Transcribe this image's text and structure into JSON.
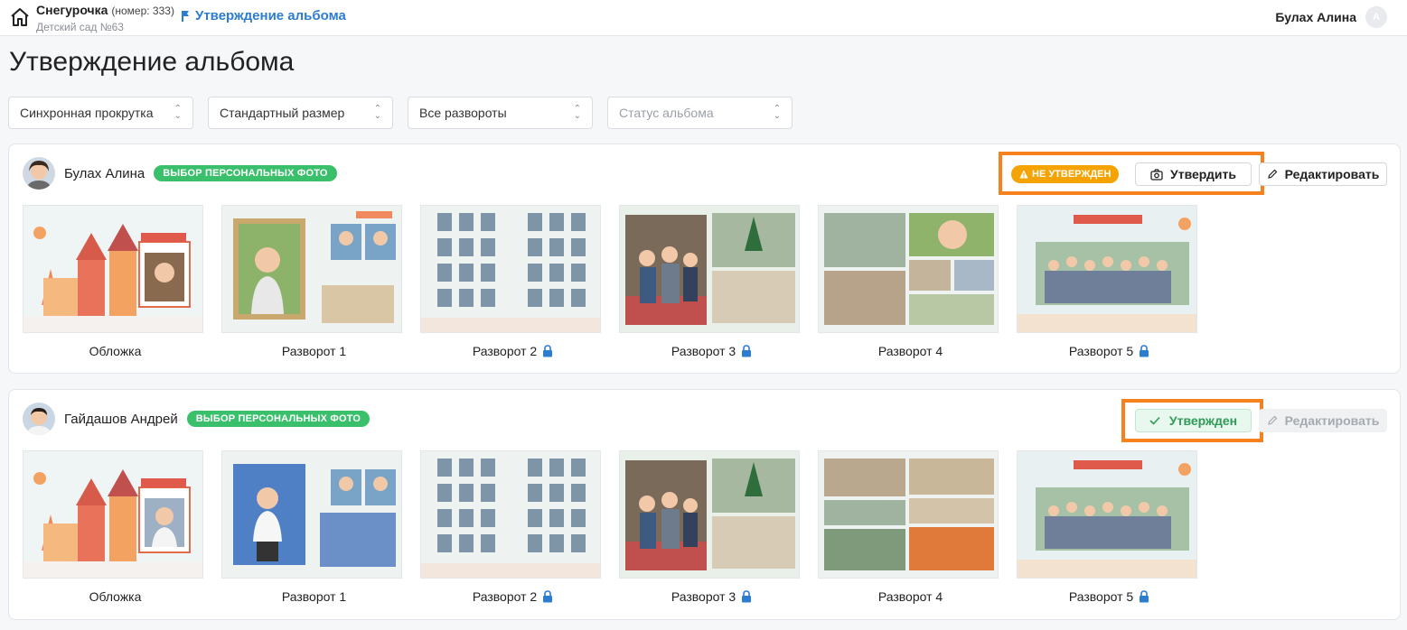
{
  "header": {
    "org_name": "Снегурочка",
    "org_number": "(номер: 333)",
    "org_sub": "Детский сад №63",
    "breadcrumb": "Утверждение альбома",
    "user_name": "Булах Алина",
    "user_initial": "А"
  },
  "page_title": "Утверждение альбома",
  "filters": {
    "scroll": "Синхронная прокрутка",
    "size": "Стандартный размер",
    "spreads": "Все развороты",
    "status_placeholder": "Статус альбома"
  },
  "albums": [
    {
      "person": "Булах Алина",
      "badge": "ВЫБОР ПЕРСОНАЛЬНЫХ ФОТО",
      "status_badge": "НЕ УТВЕРЖДЕН",
      "approve_label": "Утвердить",
      "edit_label": "Редактировать",
      "pages": [
        "Обложка",
        "Разворот 1",
        "Разворот 2",
        "Разворот 3",
        "Разворот 4",
        "Разворот 5"
      ]
    },
    {
      "person": "Гайдашов Андрей",
      "badge": "ВЫБОР ПЕРСОНАЛЬНЫХ ФОТО",
      "approved_label": "Утвержден",
      "edit_label": "Редактировать",
      "pages": [
        "Обложка",
        "Разворот 1",
        "Разворот 2",
        "Разворот 3",
        "Разворот 4",
        "Разворот 5"
      ]
    }
  ],
  "colors": {
    "accent": "#2c7cd1",
    "green": "#3ac06a",
    "warn": "#f4a300",
    "highlight": "#f5821f"
  },
  "icons": [
    "home-icon",
    "flag-icon",
    "warning-icon",
    "camera-icon",
    "pencil-icon",
    "check-icon",
    "lock-icon",
    "chevron-updown-icon"
  ]
}
